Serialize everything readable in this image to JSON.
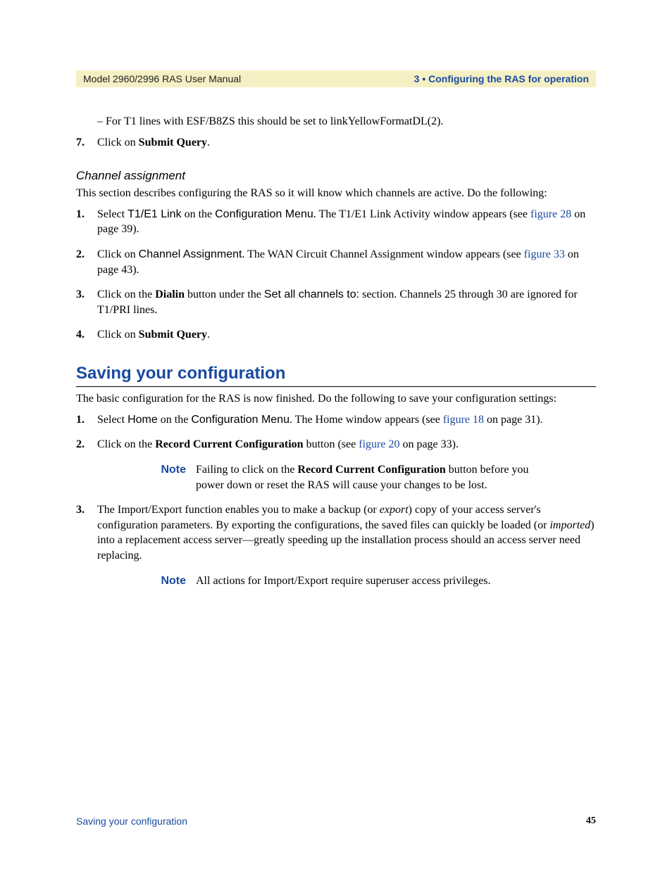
{
  "header": {
    "left": "Model 2960/2996 RAS User Manual",
    "right": "3 • Configuring the RAS for operation"
  },
  "top_dash_line": "–  For T1 lines with ESF/B8ZS this should be set to linkYellowFormatDL(2).",
  "step7_num": "7.",
  "step7_a": "Click on ",
  "step7_b": "Submit Query",
  "step7_c": ".",
  "ch_assign_heading": "Channel assignment",
  "ch_assign_intro": "This section describes configuring the RAS so it will know which channels are active. Do the following:",
  "ch_steps": [
    {
      "num": "1.",
      "parts": [
        {
          "t": "Select "
        },
        {
          "t": "T1/E1 Link",
          "cls": "sans"
        },
        {
          "t": " on the "
        },
        {
          "t": "Configuration Menu",
          "cls": "sans"
        },
        {
          "t": ". The T1/E1 Link Activity window appears (see "
        },
        {
          "t": "figure 28",
          "cls": "link"
        },
        {
          "t": " on page 39)."
        }
      ]
    },
    {
      "num": "2.",
      "parts": [
        {
          "t": "Click on "
        },
        {
          "t": "Channel Assignment",
          "cls": "sans"
        },
        {
          "t": ". The WAN Circuit Channel Assignment window appears (see "
        },
        {
          "t": "figure 33",
          "cls": "link"
        },
        {
          "t": " on page 43)."
        }
      ]
    },
    {
      "num": "3.",
      "parts": [
        {
          "t": "Click on the "
        },
        {
          "t": "Dialin",
          "cls": "bold"
        },
        {
          "t": " button under the "
        },
        {
          "t": "Set all channels to:",
          "cls": "sans"
        },
        {
          "t": " section. Channels 25 through 30 are ignored for T1/PRI lines."
        }
      ]
    },
    {
      "num": "4.",
      "parts": [
        {
          "t": "Click on "
        },
        {
          "t": "Submit Query",
          "cls": "bold"
        },
        {
          "t": "."
        }
      ]
    }
  ],
  "save_heading": "Saving your configuration",
  "save_intro": "The basic configuration for the RAS is now finished. Do the following to save your configuration settings:",
  "save_steps_a": [
    {
      "num": "1.",
      "parts": [
        {
          "t": "Select "
        },
        {
          "t": "Home",
          "cls": "sans"
        },
        {
          "t": " on the "
        },
        {
          "t": "Configuration Menu",
          "cls": "sans"
        },
        {
          "t": ". The Home window appears (see "
        },
        {
          "t": "figure 18",
          "cls": "link"
        },
        {
          "t": " on page 31)."
        }
      ]
    },
    {
      "num": "2.",
      "parts": [
        {
          "t": "Click on the "
        },
        {
          "t": "Record Current Configuration",
          "cls": "bold"
        },
        {
          "t": " button (see "
        },
        {
          "t": "figure 20",
          "cls": "link"
        },
        {
          "t": " on page 33)."
        }
      ]
    }
  ],
  "note1_label": "Note",
  "note1_parts": [
    {
      "t": "Failing to click on the "
    },
    {
      "t": "Record Current Configuration",
      "cls": "bold"
    },
    {
      "t": " button before you power down or reset the RAS will cause your changes to be lost."
    }
  ],
  "save_steps_b": [
    {
      "num": "3.",
      "parts": [
        {
          "t": "The Import/Export function enables you to make a backup (or "
        },
        {
          "t": "export",
          "cls": "ital"
        },
        {
          "t": ") copy of your access server's configuration parameters. By exporting the configurations, the saved files can quickly be loaded (or "
        },
        {
          "t": "imported",
          "cls": "ital"
        },
        {
          "t": ") into a replacement access server—greatly speeding up the installation process should an access server need replacing."
        }
      ]
    }
  ],
  "note2_label": "Note",
  "note2_text": "All actions for Import/Export require superuser access privileges.",
  "footer": {
    "left": "Saving your configuration",
    "right": "45"
  }
}
